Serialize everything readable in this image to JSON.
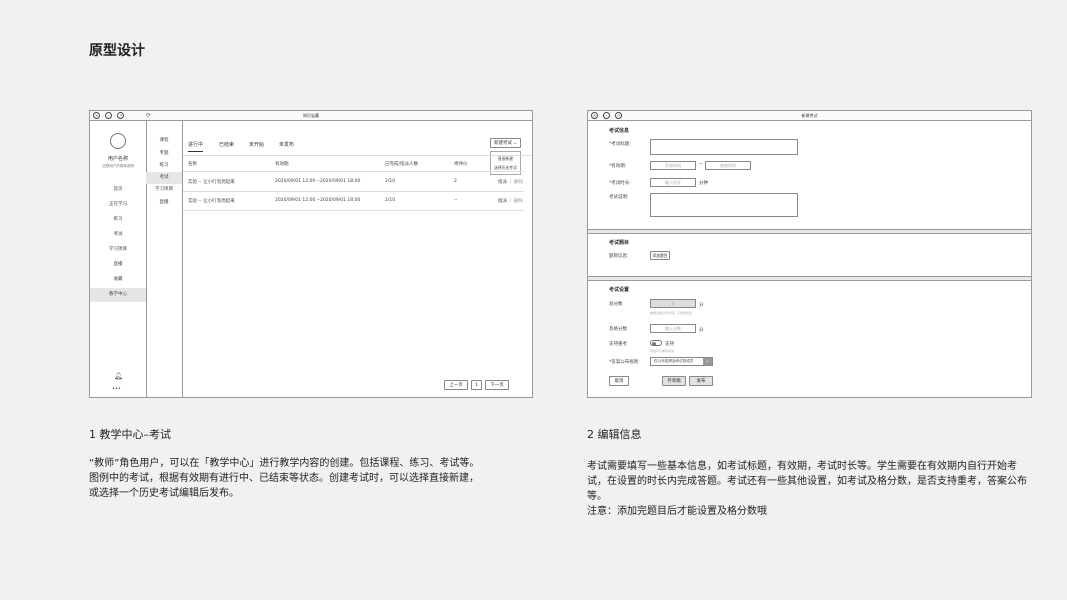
{
  "page_title": "原型设计",
  "left_window": {
    "title": "知识宝藏",
    "user": {
      "name": "用户名称",
      "desc": "这是用户的简单说明"
    },
    "nav": [
      "首页",
      "正在学习",
      "练习",
      "考试",
      "学习项目",
      "直播",
      "收藏",
      "教学中心"
    ],
    "subnav": [
      "课程",
      "专题",
      "练习",
      "考试",
      "学习项目",
      "直播"
    ],
    "tabs": [
      "进行中",
      "已结束",
      "未开始",
      "未发布"
    ],
    "new_exam_button": "新建考试",
    "dropdown": [
      "直接新建",
      "选择历史考试"
    ],
    "table": {
      "headers": [
        "名称",
        "有效期",
        "已完成/指派人数",
        "待评价"
      ],
      "rows": [
        {
          "name": "实验 -- 让小叮泡亮起来",
          "period": "2020/09/01 12:00 --2020/09/01 18:00",
          "done": "2/10",
          "pending": "2",
          "action1": "指派",
          "sep": "|",
          "action2": "删除"
        },
        {
          "name": "实验 -- 让小叮泡亮起来",
          "period": "2020/09/01 12:00 --2020/09/01 18:00",
          "done": "2/10",
          "pending": "--",
          "action1": "指派",
          "sep": "|",
          "action2": "删除"
        }
      ]
    },
    "pager": {
      "prev": "上一页",
      "page": "1",
      "next": "下一页"
    },
    "more": "•••"
  },
  "right_window": {
    "title": "新建考试",
    "info": {
      "heading": "考试信息",
      "exam_title_label": "*考试标题:",
      "period_label": "*有效期:",
      "start_placeholder": "开始时间",
      "dash": "~",
      "end_placeholder": "结束时间",
      "duration_label": "*考试时长:",
      "duration_placeholder": "输入时长",
      "duration_unit": "分钟",
      "desc_label": "考试说明:"
    },
    "questions": {
      "heading": "考试题目",
      "label": "题目信息:",
      "add_button": "添加题目"
    },
    "settings": {
      "heading": "考试设置",
      "total_label": "总分数",
      "total_value": "0",
      "total_unit": "分",
      "total_hint": "根据试题分值计算，不支持修改",
      "pass_label": "及格分数",
      "pass_placeholder": "输入分数",
      "pass_unit": "分",
      "retake_label": "支持重考",
      "retake_value": "支持",
      "retake_hint": "考完可以重新考试",
      "publish_label": "*答案公布规则:",
      "publish_value": "仅公布成绩及考试的成员",
      "cancel_button": "取消",
      "save_button": "存草稿",
      "publish_button": "发布"
    }
  },
  "caption1": "1 教学中心–考试",
  "desc1": "“教师”角色用户，可以在「教学中心」进行教学内容的创建。包括课程、练习、考试等。图例中的考试，根据有效期有进行中、已结束等状态。创建考试时，可以选择直接新建，或选择一个历史考试编辑后发布。",
  "caption2": "2 编辑信息",
  "desc2": "考试需要填写一些基本信息，如考试标题，有效期，考试时长等。学生需要在有效期内自行开始考试，在设置的时长内完成答题。考试还有一些其他设置，如考试及格分数，是否支持重考，答案公布等。",
  "desc2_note": "注意：添加完题目后才能设置及格分数哦"
}
